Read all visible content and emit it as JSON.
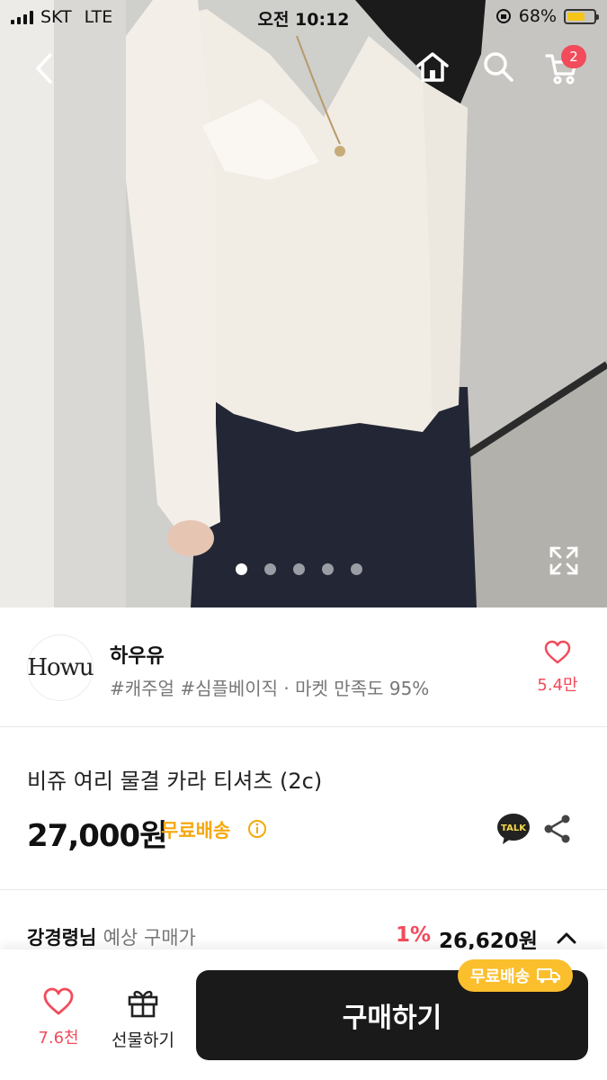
{
  "status_bar": {
    "carrier": "SKT",
    "network": "LTE",
    "time": "오전 10:12",
    "battery_percent": "68%",
    "battery_level": 0.68,
    "battery_color": "#f5c518"
  },
  "top_nav": {
    "back_icon": "chevron-left-icon",
    "home_icon": "home-icon",
    "search_icon": "search-icon",
    "cart_icon": "cart-icon",
    "cart_count": "2"
  },
  "gallery": {
    "total_slides": 5,
    "active_slide": 1,
    "expand_icon": "expand-icon"
  },
  "shop": {
    "logo_text": "Howu",
    "name": "하우유",
    "tags": "#캐주얼 #심플베이직 · 마켓 만족도 95%",
    "like_count": "5.4만"
  },
  "product": {
    "title": "비쥬 여리 물결 카라 티셔츠 (2c)",
    "price": "27,000원",
    "shipping": "무료배송",
    "info_icon": "info-icon",
    "talk_label": "TALK",
    "share_icon": "share-icon"
  },
  "expected_price": {
    "user": "강경령님",
    "label": "예상 구매가",
    "discount": "1%",
    "amount": "26,620원"
  },
  "bottom_bar": {
    "wish_count": "7.6천",
    "gift_label": "선물하기",
    "buy_label": "구매하기",
    "ship_chip": "무료배송"
  },
  "colors": {
    "accent_red": "#f24b5b",
    "ship_yellow": "#f5a80c",
    "buy_button": "#1a1a1a"
  }
}
